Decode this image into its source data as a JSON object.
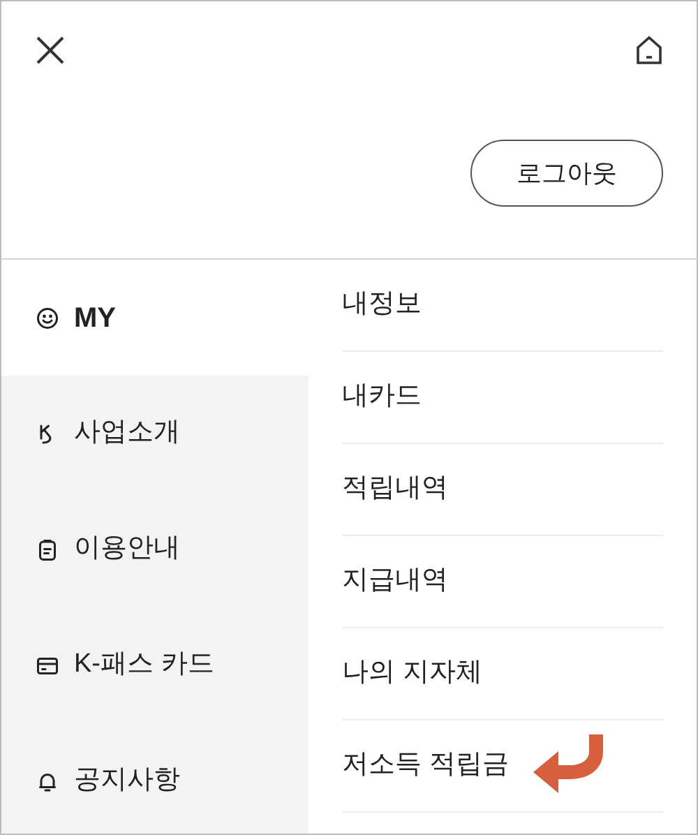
{
  "header": {
    "logout_button": "로그아웃"
  },
  "categories": [
    {
      "label": "MY",
      "kind": "smile",
      "selected": true
    },
    {
      "label": "사업소개",
      "kind": "logo",
      "selected": false
    },
    {
      "label": "이용안내",
      "kind": "clipboard",
      "selected": false
    },
    {
      "label": "K-패스 카드",
      "kind": "card",
      "selected": false
    },
    {
      "label": "공지사항",
      "kind": "bell",
      "selected": false
    }
  ],
  "submenu": [
    {
      "label": "내정보",
      "pointed": false
    },
    {
      "label": "내카드",
      "pointed": false
    },
    {
      "label": "적립내역",
      "pointed": false
    },
    {
      "label": "지급내역",
      "pointed": false
    },
    {
      "label": "나의 지자체",
      "pointed": false
    },
    {
      "label": "저소득 적립금",
      "pointed": true
    }
  ]
}
